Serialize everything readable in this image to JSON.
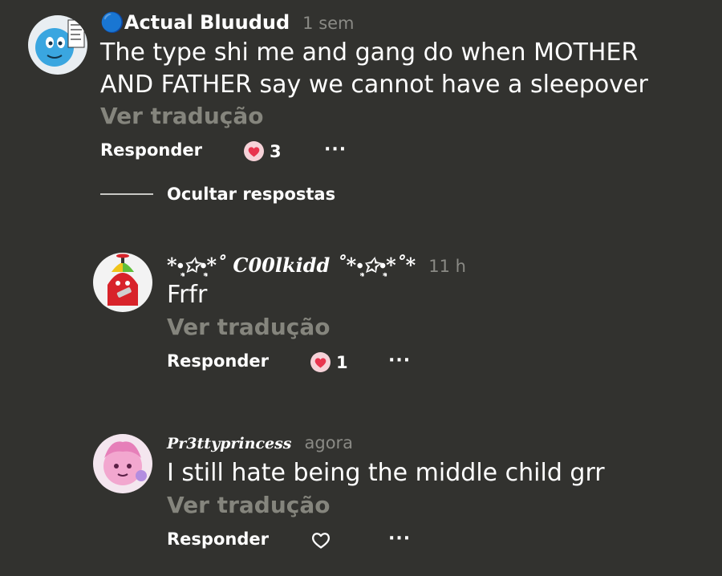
{
  "comments": [
    {
      "username": "🔵Actual Bluudud",
      "time": "1 sem",
      "text_lines": [
        "The type shi me and gang do when MOTHER",
        "AND FATHER say we cannot have a sleepover"
      ],
      "translate_label": "Ver tradução",
      "reply_label": "Responder",
      "likes": "3",
      "liked": true,
      "more_label": "···"
    }
  ],
  "hide_replies_label": "Ocultar respostas",
  "replies": [
    {
      "username": "*•̩̩͙✩•̩̩͙*˚ C00lkidd ˚*•̩̩͙✩•̩̩͙*˚*",
      "time": "11 h",
      "text": "Frfr",
      "translate_label": "Ver tradução",
      "reply_label": "Responder",
      "likes": "1",
      "liked": true,
      "more_label": "···"
    },
    {
      "username": "Pr3ttyprincess",
      "time": "agora",
      "text": "I still hate being the middle child grr",
      "translate_label": "Ver tradução",
      "reply_label": "Responder",
      "likes": "",
      "liked": false,
      "more_label": "···"
    }
  ],
  "colors": {
    "background": "#32322f",
    "muted_text": "#85857d",
    "timestamp": "#8a8a85",
    "heart_liked": "#e8344e"
  },
  "icons": {
    "liked_heart": "heart-filled-icon",
    "unliked_heart": "heart-outline-icon",
    "more": "more-icon"
  }
}
